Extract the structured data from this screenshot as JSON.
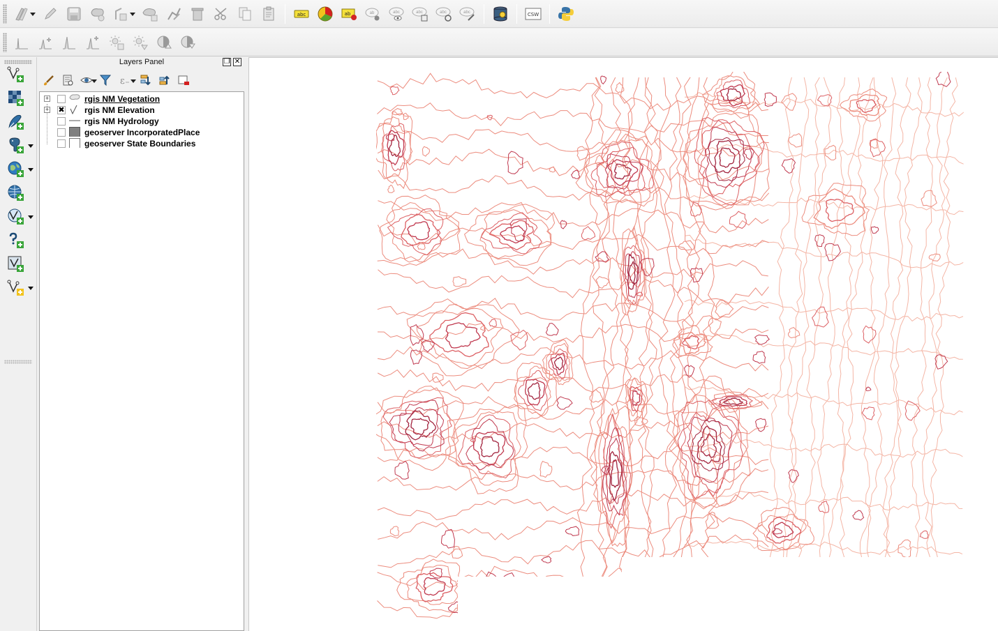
{
  "toolbar_top": {
    "items": [
      {
        "icon": "current-edits-icon",
        "dropdown": true
      },
      {
        "icon": "toggle-editing-icon"
      },
      {
        "icon": "save-edits-icon"
      },
      {
        "icon": "add-feature-icon"
      },
      {
        "icon": "move-feature-icon",
        "dropdown": true
      },
      {
        "icon": "node-tool-icon"
      },
      {
        "icon": "delete-selected-icon"
      },
      {
        "icon": "cut-features-icon"
      },
      {
        "icon": "copy-features-icon"
      },
      {
        "icon": "paste-features-icon"
      },
      {
        "icon": "label-abc-icon",
        "text": "abc"
      },
      {
        "icon": "diagram-icon"
      },
      {
        "icon": "pin-label-icon",
        "text": "ab"
      },
      {
        "icon": "highlight-pinned-label-icon",
        "text": "ab"
      },
      {
        "icon": "show-hide-label-icon",
        "text": "abc"
      },
      {
        "icon": "move-label-icon",
        "text": "abc"
      },
      {
        "icon": "rotate-label-icon",
        "text": "abc"
      },
      {
        "icon": "change-label-icon",
        "text": "abc"
      },
      {
        "icon": "db-manager-icon"
      },
      {
        "icon": "metasearch-csw-icon",
        "text": "CSW"
      },
      {
        "icon": "python-console-icon"
      }
    ]
  },
  "toolbar_second": {
    "items": [
      {
        "icon": "raster-histogram-icon"
      },
      {
        "icon": "raster-stretch-icon"
      },
      {
        "icon": "raster-stretch-2-icon"
      },
      {
        "icon": "raster-stretch-3-icon"
      },
      {
        "icon": "increase-brightness-icon"
      },
      {
        "icon": "decrease-brightness-icon"
      },
      {
        "icon": "increase-contrast-icon"
      },
      {
        "icon": "decrease-contrast-icon"
      }
    ]
  },
  "left_toolbar": {
    "items": [
      {
        "icon": "add-vector-layer-icon",
        "dropdown": false
      },
      {
        "icon": "add-raster-layer-icon",
        "dropdown": false
      },
      {
        "icon": "add-spatialite-layer-icon",
        "dropdown": false
      },
      {
        "icon": "add-postgis-layer-icon",
        "dropdown": true
      },
      {
        "icon": "add-wms-layer-icon",
        "dropdown": true
      },
      {
        "icon": "add-wcs-layer-icon",
        "dropdown": false
      },
      {
        "icon": "add-wfs-layer-icon",
        "dropdown": true
      },
      {
        "icon": "add-delimited-text-icon",
        "dropdown": false
      },
      {
        "icon": "add-virtual-layer-icon",
        "dropdown": false
      },
      {
        "icon": "new-shapefile-icon",
        "dropdown": true
      }
    ]
  },
  "layers_panel": {
    "title": "Layers Panel",
    "float_label": "❐",
    "close_label": "✕",
    "tools": [
      {
        "icon": "style-manager-icon"
      },
      {
        "icon": "add-group-icon"
      },
      {
        "icon": "manage-visibility-icon",
        "dropdown": true
      },
      {
        "icon": "filter-legend-icon"
      },
      {
        "icon": "filter-expression-icon",
        "dropdown": true
      },
      {
        "icon": "expand-all-icon"
      },
      {
        "icon": "collapse-all-icon"
      },
      {
        "icon": "remove-layer-icon"
      }
    ],
    "layers": [
      {
        "name": "rgis NM Vegetation",
        "checked": false,
        "expandable": true,
        "symbol": "polygon",
        "underline": true
      },
      {
        "name": "rgis NM Elevation",
        "checked": true,
        "expandable": true,
        "symbol": "line",
        "underline": false
      },
      {
        "name": "rgis NM Hydrology",
        "checked": false,
        "expandable": false,
        "symbol": "hline",
        "underline": false
      },
      {
        "name": "geoserver IncorporatedPlace",
        "checked": false,
        "expandable": false,
        "symbol": "gray-fill",
        "underline": false
      },
      {
        "name": "geoserver State Boundaries",
        "checked": false,
        "expandable": false,
        "symbol": "white-fill",
        "underline": false
      }
    ]
  },
  "map": {
    "layer_shown": "rgis NM Elevation",
    "contour_colors": [
      "#f4b5a5",
      "#ec8c7e",
      "#dc5f63",
      "#c0394f",
      "#a3253f"
    ]
  }
}
